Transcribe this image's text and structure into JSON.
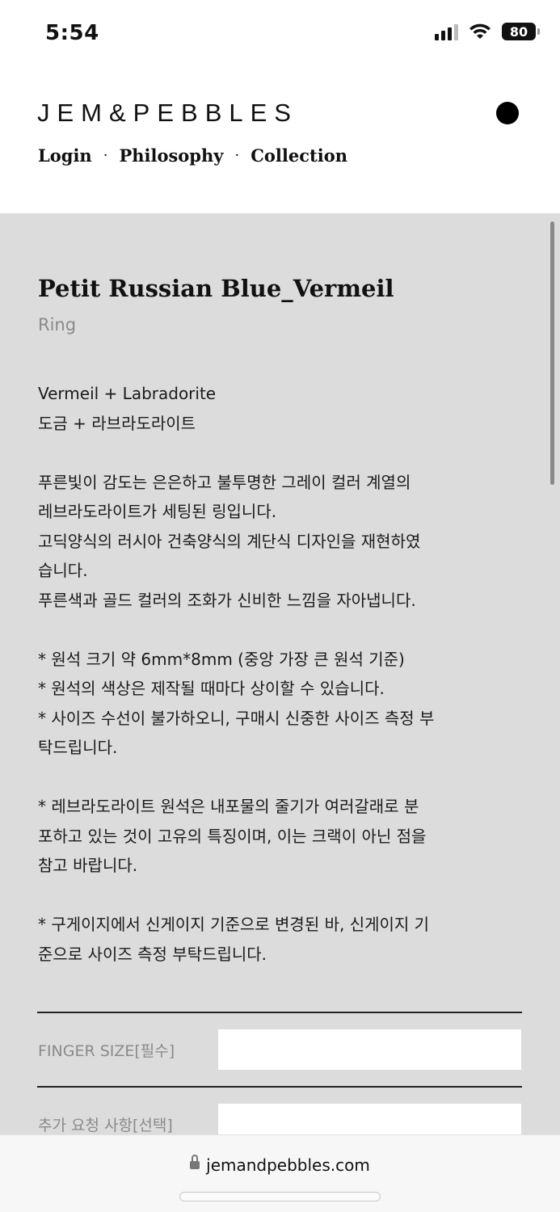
{
  "status_bar": {
    "time": "5:54",
    "battery": "80"
  },
  "header": {
    "logo": "JEM&PEBBLES",
    "nav": [
      {
        "label": "Login"
      },
      {
        "label": "Philosophy"
      },
      {
        "label": "Collection"
      }
    ],
    "nav_separator": "·"
  },
  "product": {
    "title": "Petit Russian Blue_Vermeil",
    "category": "Ring",
    "description": [
      [
        "Vermeil + Labradorite",
        "도금 + 라브라도라이트"
      ],
      [
        "푸른빛이 감도는 은은하고 불투명한 그레이 컬러 계열의",
        "레브라도라이트가 세팅된 링입니다.",
        "고딕양식의 러시아 건축양식의 계단식 디자인을 재현하였",
        "습니다.",
        "푸른색과 골드 컬러의 조화가 신비한 느낌을 자아냅니다."
      ],
      [
        "* 원석 크기 약 6mm*8mm (중앙 가장 큰 원석 기준)",
        "* 원석의 색상은 제작될 때마다 상이할 수 있습니다.",
        "* 사이즈 수선이 불가하오니, 구매시 신중한 사이즈 측정 부",
        "탁드립니다."
      ],
      [
        "* 레브라도라이트 원석은 내포물의 줄기가 여러갈래로 분",
        "포하고 있는 것이 고유의 특징이며, 이는 크랙이 아닌 점을",
        "참고 바랍니다."
      ],
      [
        "* 구게이지에서 신게이지 기준으로 변경된 바, 신게이지 기",
        "준으로 사이즈 측정 부탁드립니다."
      ]
    ]
  },
  "form": {
    "finger_size_label": "FINGER SIZE[필수]",
    "finger_size_value": "",
    "request_label": "추가 요청 사항[선택]",
    "request_value": ""
  },
  "browser": {
    "url": "jemandpebbles.com"
  },
  "colors": {
    "content_bg": "#dcdcdc",
    "header_bg": "#ffffff",
    "muted_text": "#8a8a8a"
  }
}
